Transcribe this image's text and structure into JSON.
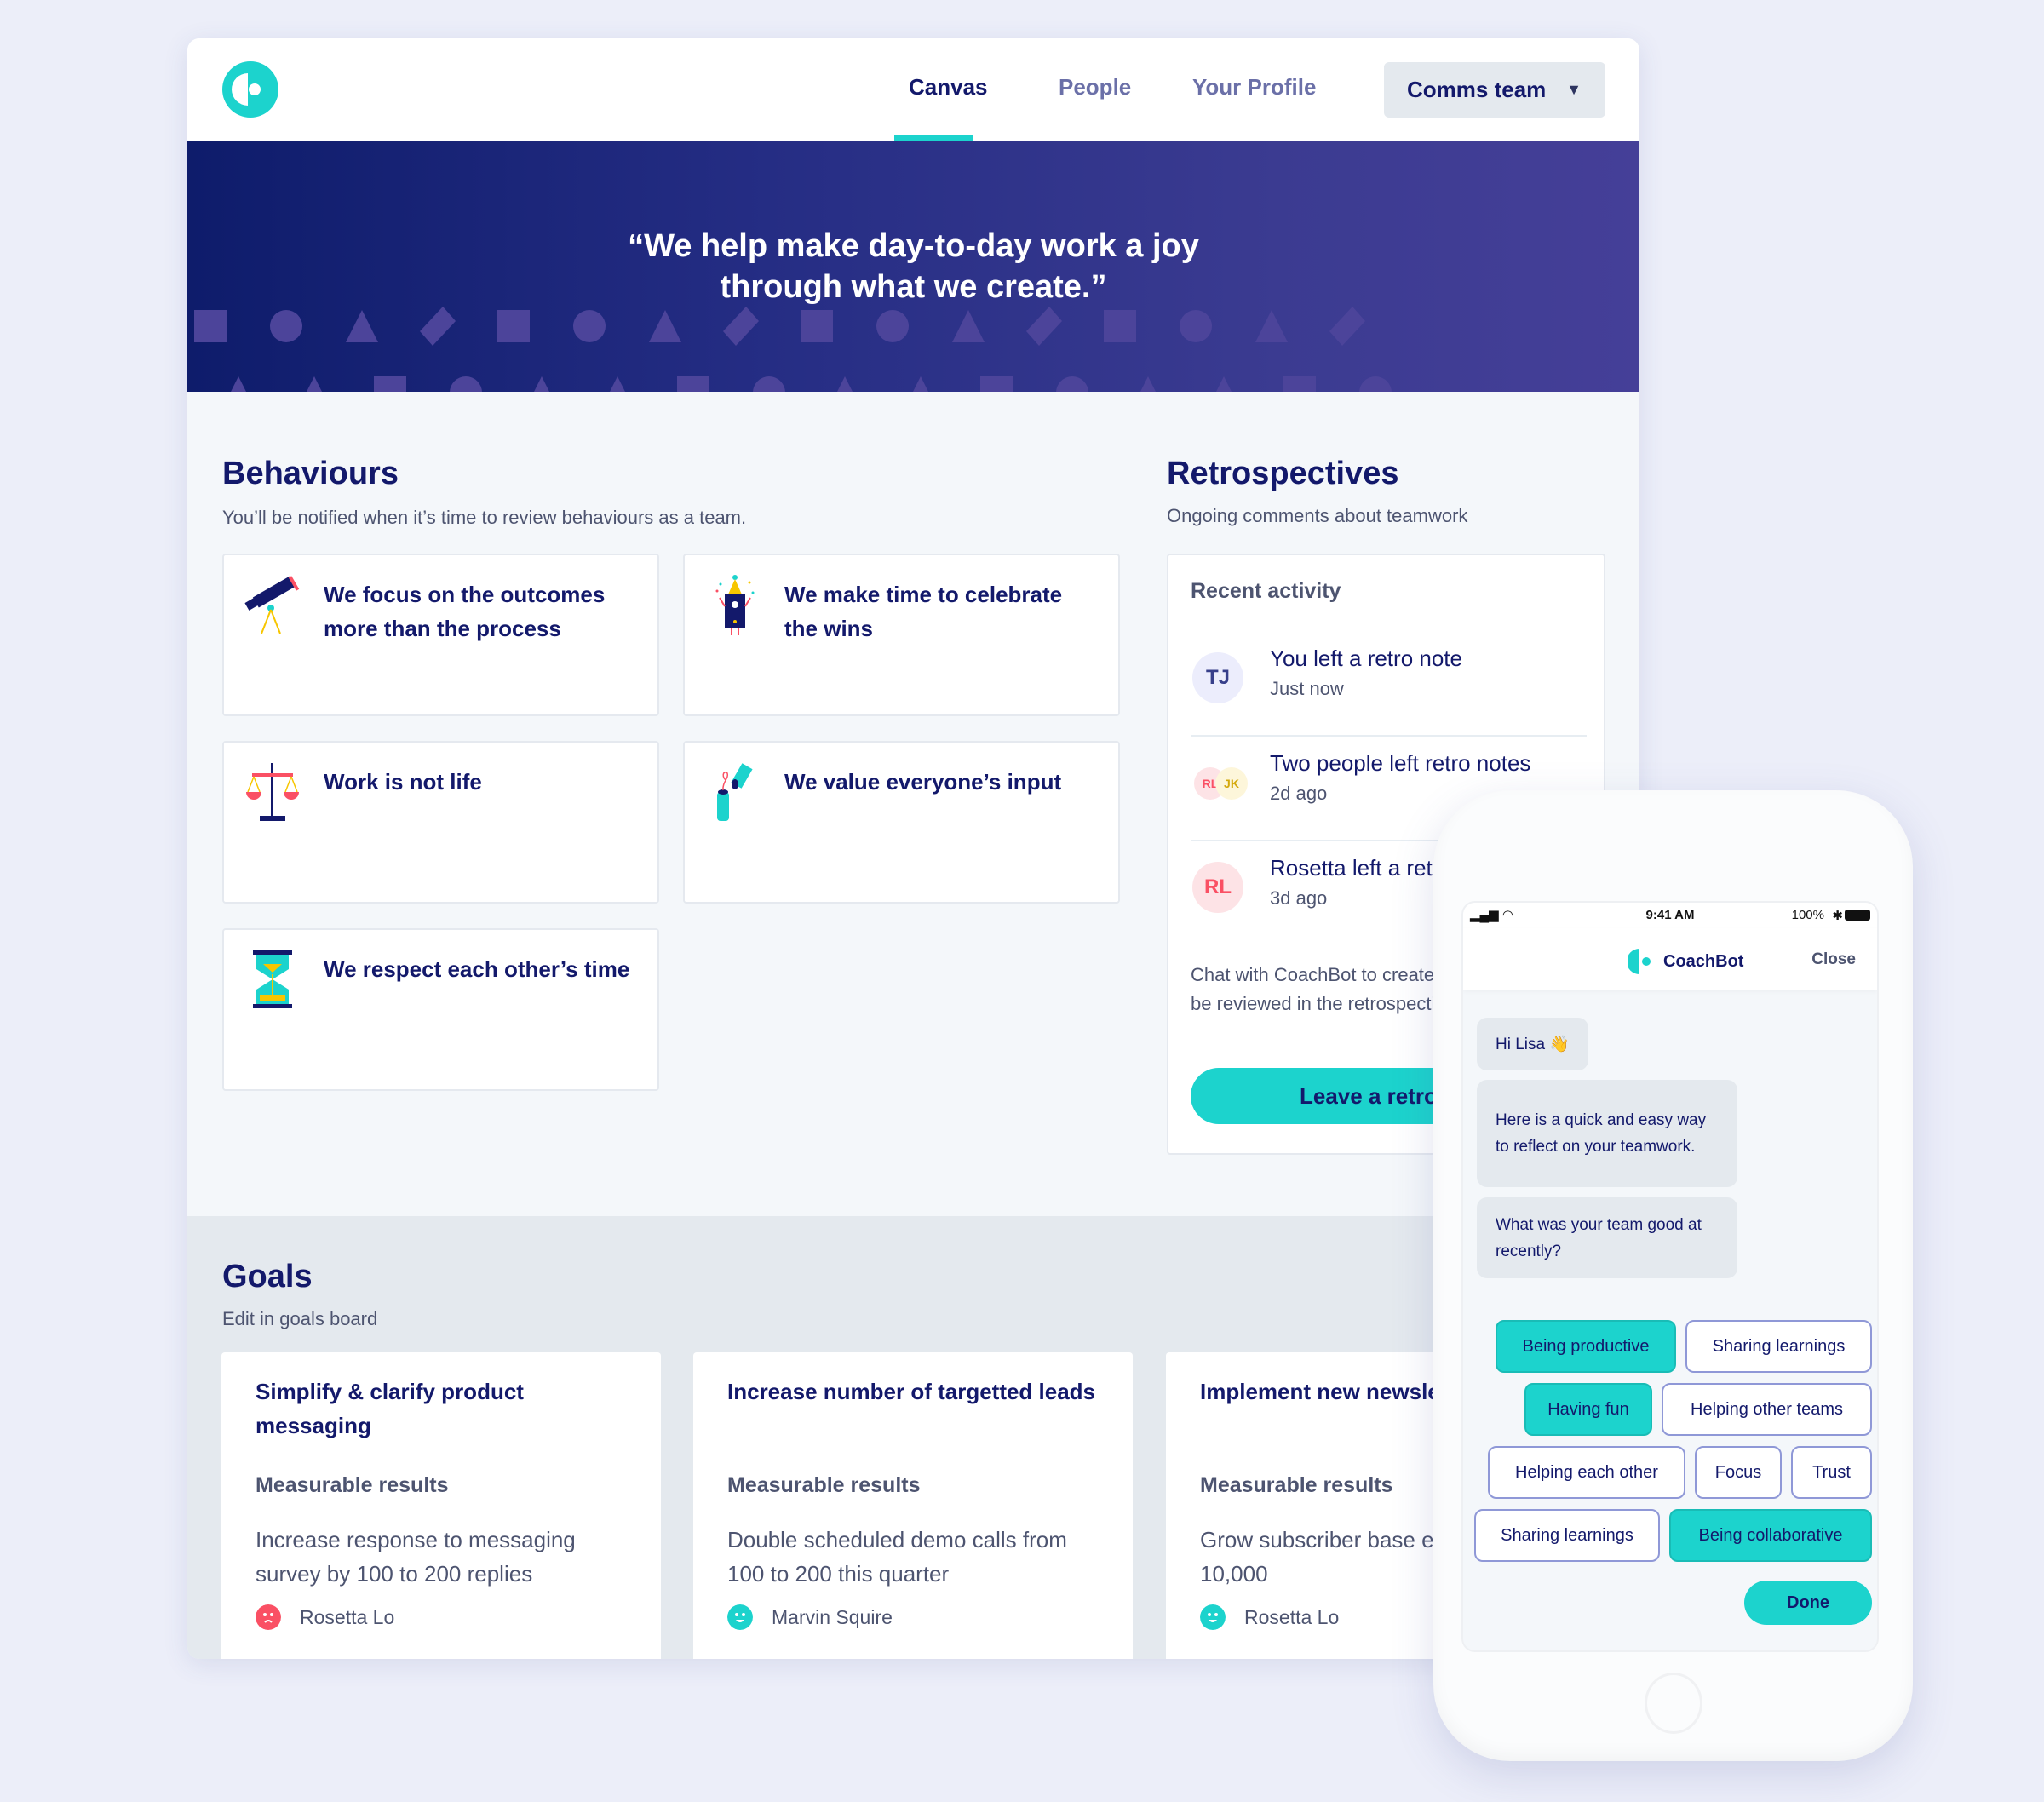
{
  "header": {
    "nav": [
      {
        "label": "Canvas",
        "active": true
      },
      {
        "label": "People",
        "active": false
      },
      {
        "label": "Your Profile",
        "active": false
      }
    ],
    "team_select": "Comms team"
  },
  "banner": {
    "quote_line1": "“We help make day-to-day work a joy",
    "quote_line2": "through what we create.”"
  },
  "behaviours": {
    "title": "Behaviours",
    "subtitle": "You’ll be notified when it’s time to review behaviours as a team.",
    "items": [
      {
        "label": "We focus on the outcomes more than the process",
        "icon": "telescope-icon"
      },
      {
        "label": "We make time to celebrate the wins",
        "icon": "party-robot-icon"
      },
      {
        "label": "Work is not life",
        "icon": "scales-icon"
      },
      {
        "label": "We value everyone’s input",
        "icon": "salt-shaker-icon"
      },
      {
        "label": "We respect each other’s time",
        "icon": "hourglass-icon"
      }
    ]
  },
  "retrospectives": {
    "title": "Retrospectives",
    "subtitle": "Ongoing comments about teamwork",
    "recent_title": "Recent activity",
    "activity": [
      {
        "avatars": [
          "TJ"
        ],
        "text": "You left a retro note",
        "time": "Just now"
      },
      {
        "avatars": [
          "RL",
          "JK"
        ],
        "text": "Two people left retro notes",
        "time": "2d ago"
      },
      {
        "avatars": [
          "RL"
        ],
        "text": "Rosetta left a retro note",
        "time": "3d ago"
      }
    ],
    "description": "Chat with CoachBot to create a note. Notes will be reviewed in the retrospective session.",
    "button": "Leave a retro note"
  },
  "goals": {
    "title": "Goals",
    "subtitle": "Edit in goals board",
    "cards": [
      {
        "title": "Simplify & clarify product messaging",
        "results_label": "Measurable results",
        "result": "Increase response to messaging survey by 100 to 200 replies",
        "owner": "Rosetta Lo",
        "mood": "sad",
        "mood_color": "#fa5064"
      },
      {
        "title": "Increase number of targetted leads",
        "results_label": "Measurable results",
        "result": "Double scheduled demo calls from 100 to 200 this quarter",
        "owner": "Marvin Squire",
        "mood": "happy",
        "mood_color": "#1cd3cd"
      },
      {
        "title": "Implement new newsletter",
        "results_label": "Measurable results",
        "result": "Grow subscriber base each week to 10,000",
        "owner": "Rosetta Lo",
        "mood": "happy",
        "mood_color": "#1cd3cd"
      }
    ]
  },
  "phone": {
    "status_time": "9:41 AM",
    "battery": "100%",
    "bot_name": "CoachBot",
    "close_label": "Close",
    "messages": [
      "Hi Lisa 👋",
      "Here is a quick and easy way to reflect on your teamwork.",
      "What was your team good at recently?"
    ],
    "chips": [
      {
        "label": "Being productive",
        "selected": true
      },
      {
        "label": "Sharing learnings",
        "selected": false
      },
      {
        "label": "Having fun",
        "selected": true
      },
      {
        "label": "Helping other teams",
        "selected": false
      },
      {
        "label": "Helping each other",
        "selected": false
      },
      {
        "label": "Focus",
        "selected": false
      },
      {
        "label": "Trust",
        "selected": false
      },
      {
        "label": "Sharing learnings",
        "selected": false
      },
      {
        "label": "Being collaborative",
        "selected": true
      }
    ],
    "done_label": "Done"
  },
  "colors": {
    "accent": "#1cd3cd",
    "navy": "#13196b",
    "coral": "#fa5064",
    "gold": "#d4a90c"
  }
}
